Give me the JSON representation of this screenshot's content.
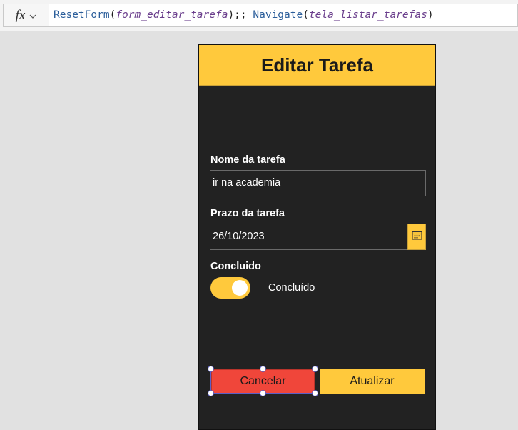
{
  "formula_bar": {
    "fx_label": "fx",
    "tokens": [
      {
        "text": "ResetForm",
        "kind": "fn"
      },
      {
        "text": "(",
        "kind": "punc"
      },
      {
        "text": "form_editar_tarefa",
        "kind": "arg"
      },
      {
        "text": ");; ",
        "kind": "punc"
      },
      {
        "text": "Navigate",
        "kind": "fn"
      },
      {
        "text": "(",
        "kind": "punc"
      },
      {
        "text": "tela_listar_tarefas",
        "kind": "arg"
      },
      {
        "text": ")",
        "kind": "punc"
      }
    ]
  },
  "screen": {
    "title": "Editar Tarefa",
    "fields": {
      "name_label": "Nome da tarefa",
      "name_value": "ir na academia",
      "deadline_label": "Prazo da tarefa",
      "deadline_value": "26/10/2023",
      "done_label": "Concluido",
      "done_toggle_text": "Concluído"
    },
    "buttons": {
      "cancel": "Cancelar",
      "update": "Atualizar"
    }
  },
  "colors": {
    "accent": "#ffc93c",
    "danger": "#f0463a",
    "screen_bg": "#222222",
    "selection": "#5b5fc7"
  },
  "icons": {
    "fx": "fx-icon",
    "dropdown": "chevron-down-icon",
    "calendar": "calendar-icon"
  }
}
